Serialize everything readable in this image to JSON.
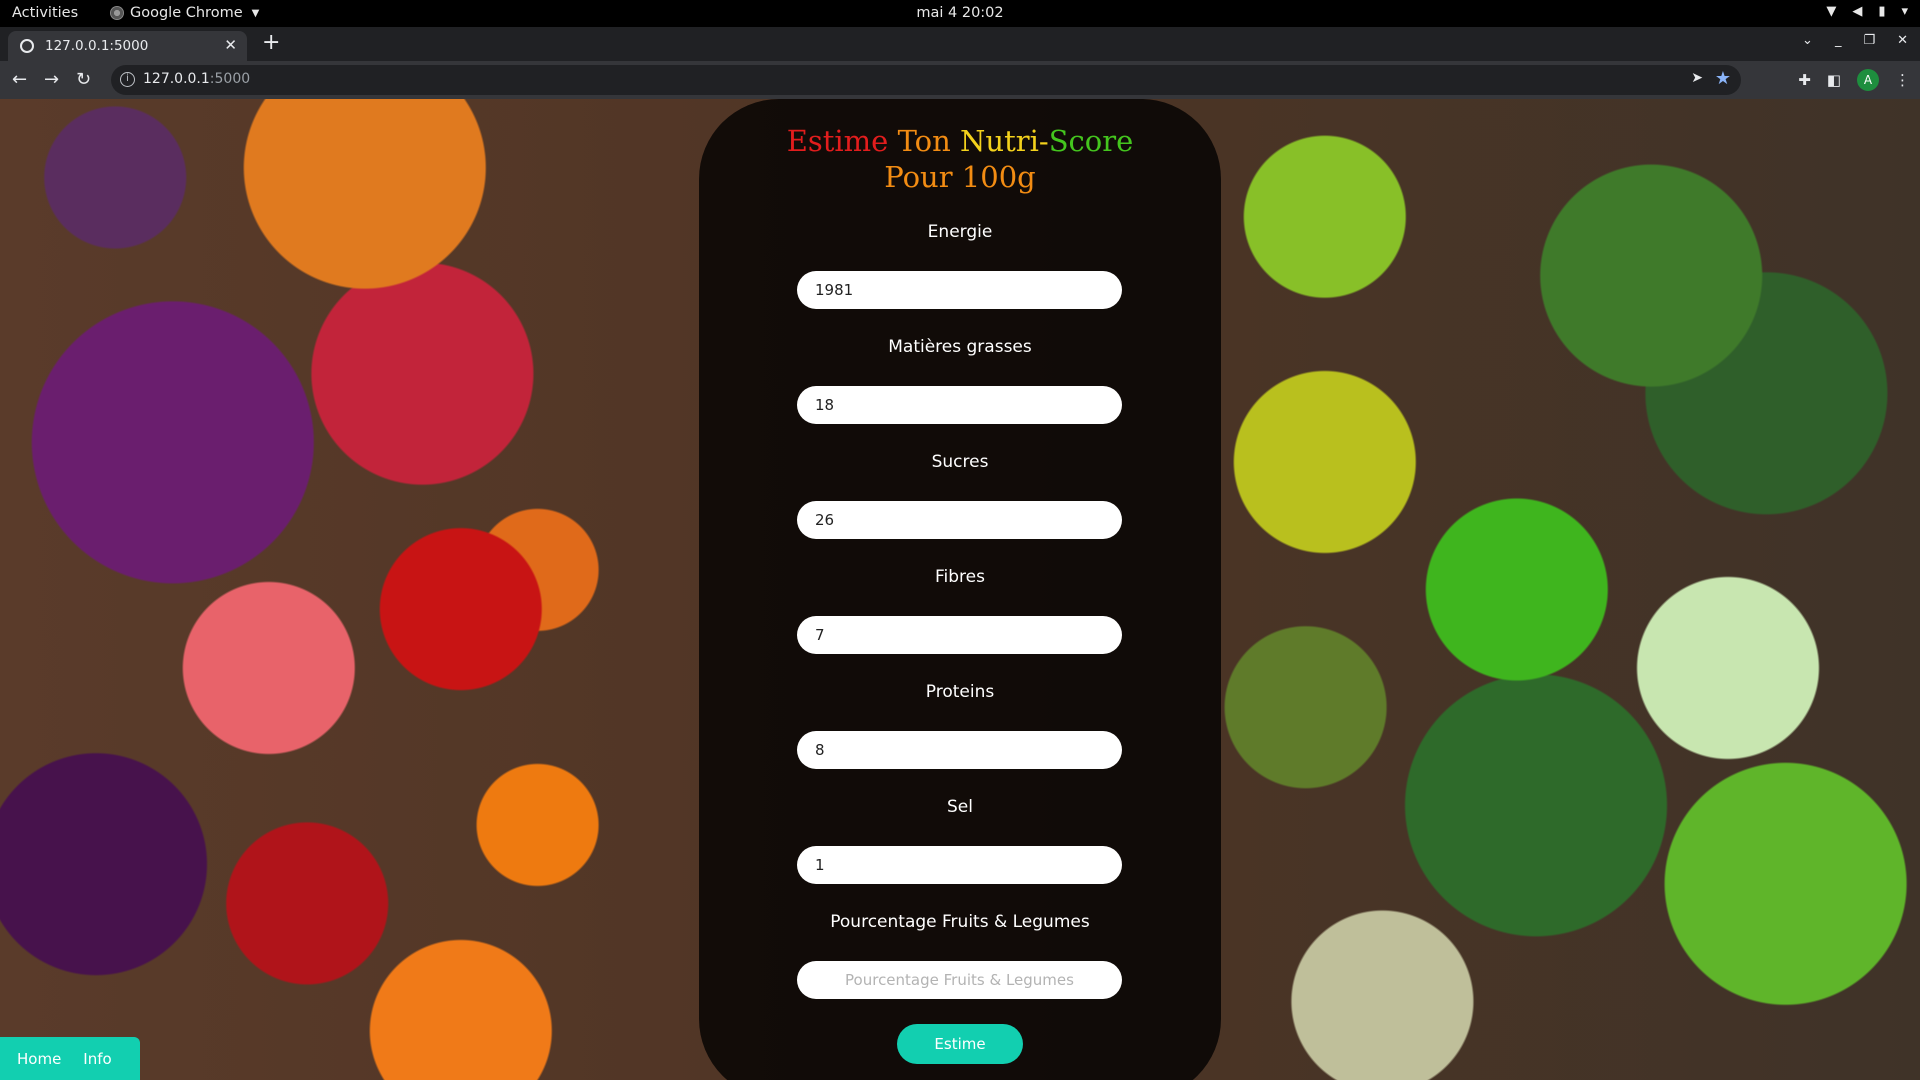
{
  "system_bar": {
    "activities": "Activities",
    "app_name": "Google Chrome",
    "clock": "mai 4  20:02"
  },
  "browser": {
    "tab_title": "127.0.0.1:5000",
    "url_host": "127.0.0.1",
    "url_port": ":5000",
    "avatar_letter": "A"
  },
  "form": {
    "title_words": [
      "Estime",
      "Ton",
      "Nutri-",
      "Score"
    ],
    "title_line2": "Pour 100g",
    "fields": [
      {
        "label": "Energie",
        "value": "1981",
        "placeholder": ""
      },
      {
        "label": "Matières grasses",
        "value": "18",
        "placeholder": ""
      },
      {
        "label": "Sucres",
        "value": "26",
        "placeholder": ""
      },
      {
        "label": "Fibres",
        "value": "7",
        "placeholder": ""
      },
      {
        "label": "Proteins",
        "value": "8",
        "placeholder": ""
      },
      {
        "label": "Sel",
        "value": "1",
        "placeholder": ""
      },
      {
        "label": "Pourcentage Fruits & Legumes",
        "value": "",
        "placeholder": "Pourcentage Fruits & Legumes"
      }
    ],
    "submit_label": "Estime"
  },
  "nav": {
    "home": "Home",
    "info": "Info"
  },
  "colors": {
    "accent": "#12cfb0",
    "title_red": "#e21d1d",
    "title_orange": "#f28c13",
    "title_yellow": "#f4d21c",
    "title_green": "#44c51e"
  }
}
